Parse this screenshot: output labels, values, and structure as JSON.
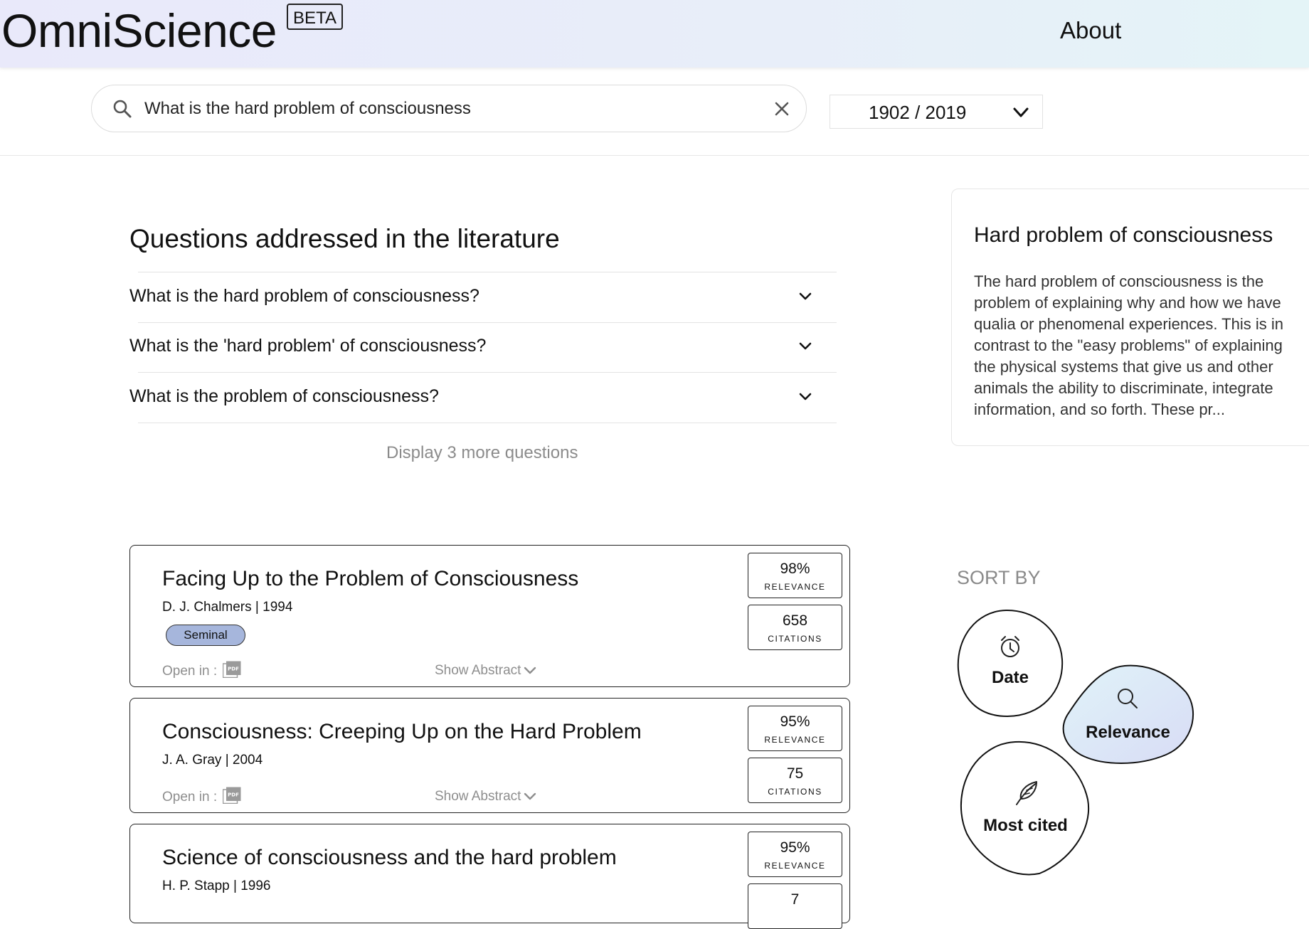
{
  "header": {
    "logo": "OmniScience",
    "beta": "BETA",
    "about": "About"
  },
  "search": {
    "query": "What is the hard problem of consciousness",
    "year_range": "1902 / 2019"
  },
  "questions": {
    "title": "Questions addressed in the literature",
    "items": [
      {
        "text": "What is the hard problem of consciousness?"
      },
      {
        "text": "What is the 'hard problem' of consciousness?"
      },
      {
        "text": "What is the problem of consciousness?"
      }
    ],
    "more_label": "Display 3 more questions"
  },
  "wiki": {
    "title": "Hard problem of consciousness",
    "body": "The hard problem of consciousness is the problem of explaining why and how we have qualia or phenomenal experiences. This is in contrast to the \"easy problems\" of explaining the physical systems that give us and other animals the ability to discriminate, integrate information, and so forth. These pr..."
  },
  "papers": [
    {
      "title": "Facing Up to the Problem of Consciousness",
      "meta": "D. J. Chalmers  |  1994",
      "badge": "Seminal",
      "open_in": "Open in :",
      "show_abstract": "Show Abstract",
      "relevance": "98%",
      "relevance_label": "RELEVANCE",
      "citations": "658",
      "citations_label": "CITATIONS"
    },
    {
      "title": "Consciousness: Creeping Up on the Hard Problem",
      "meta": "J. A. Gray  |  2004",
      "open_in": "Open in :",
      "show_abstract": "Show Abstract",
      "relevance": "95%",
      "relevance_label": "RELEVANCE",
      "citations": "75",
      "citations_label": "CITATIONS"
    },
    {
      "title": "Science of consciousness and the hard problem",
      "meta": "H. P. Stapp  |  1996",
      "relevance": "95%",
      "relevance_label": "RELEVANCE",
      "citations": "7"
    }
  ],
  "sort": {
    "title": "SORT BY",
    "options": [
      {
        "label": "Date",
        "icon": "clock-icon"
      },
      {
        "label": "Relevance",
        "icon": "search-icon",
        "selected": true
      },
      {
        "label": "Most cited",
        "icon": "feather-icon"
      }
    ]
  }
}
